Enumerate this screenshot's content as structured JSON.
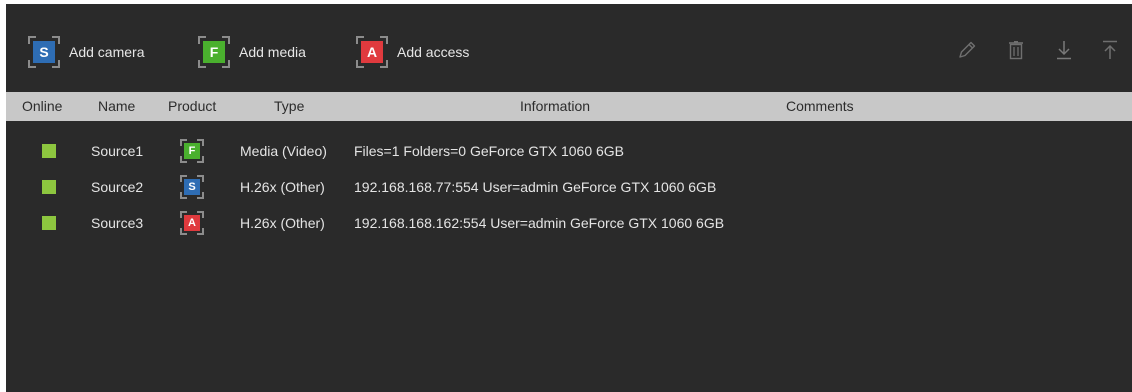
{
  "colors": {
    "background": "#2a2a2a",
    "header_bg": "#c8c8c8",
    "online": "#8dc63f",
    "camera_blue": "#2e6db4",
    "media_green": "#4ab02e",
    "access_red": "#e03a3e"
  },
  "toolbar": {
    "add_camera": {
      "badge": "S",
      "label": "Add camera",
      "color": "#2e6db4"
    },
    "add_media": {
      "badge": "F",
      "label": "Add media",
      "color": "#4ab02e"
    },
    "add_access": {
      "badge": "A",
      "label": "Add access",
      "color": "#e03a3e"
    },
    "tools": [
      "pencil-icon",
      "trash-icon",
      "download-icon",
      "upload-icon"
    ]
  },
  "table": {
    "columns": {
      "online": "Online",
      "name": "Name",
      "product": "Product",
      "type": "Type",
      "information": "Information",
      "comments": "Comments"
    },
    "rows": [
      {
        "online": true,
        "name": "Source1",
        "product_badge": "F",
        "product_color": "#4ab02e",
        "type": "Media (Video)",
        "information": "Files=1 Folders=0  GeForce GTX 1060 6GB",
        "comments": ""
      },
      {
        "online": true,
        "name": "Source2",
        "product_badge": "S",
        "product_color": "#2e6db4",
        "type": "H.26x (Other)",
        "information": "192.168.168.77:554 User=admin GeForce GTX 1060 6GB",
        "comments": ""
      },
      {
        "online": true,
        "name": "Source3",
        "product_badge": "A",
        "product_color": "#e03a3e",
        "type": "H.26x (Other)",
        "information": "192.168.168.162:554 User=admin GeForce GTX 1060 6GB",
        "comments": ""
      }
    ]
  }
}
